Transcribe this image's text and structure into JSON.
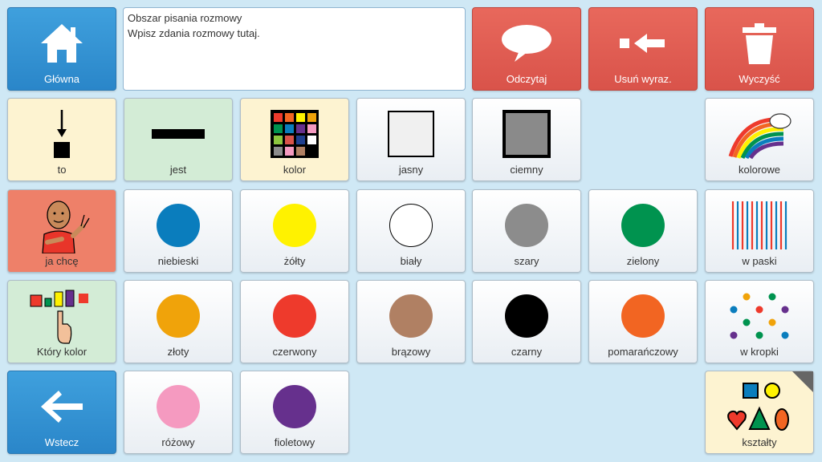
{
  "toolbar": {
    "home_label": "Główna",
    "speak_label": "Odczytaj",
    "delete_word_label": "Usuń wyraz.",
    "clear_label": "Wyczyść",
    "back_label": "Wstecz"
  },
  "message_area": {
    "line1": "Obszar pisania rozmowy",
    "line2": "Wpisz zdania rozmowy tutaj."
  },
  "words": {
    "to": "to",
    "jest": "jest",
    "kolor": "kolor",
    "jasny": "jasny",
    "ciemny": "ciemny",
    "kolorowe": "kolorowe",
    "ja_chce": "ja chcę",
    "w_paski": "w paski",
    "ktory_kolor": "Który kolor",
    "w_kropki": "w kropki",
    "ksztalty": "kształty"
  },
  "colors": {
    "niebieski": {
      "label": "niebieski",
      "hex": "#0a7dbd"
    },
    "zolty": {
      "label": "żółty",
      "hex": "#fff200"
    },
    "bialy": {
      "label": "biały",
      "hex": "#ffffff"
    },
    "szary": {
      "label": "szary",
      "hex": "#8c8c8c"
    },
    "zielony": {
      "label": "zielony",
      "hex": "#00934f"
    },
    "zloty": {
      "label": "złoty",
      "hex": "#f0a30a"
    },
    "czerwony": {
      "label": "czerwony",
      "hex": "#ee3a2c"
    },
    "brazowy": {
      "label": "brązowy",
      "hex": "#b08063"
    },
    "czarny": {
      "label": "czarny",
      "hex": "#000000"
    },
    "pomaranczowy": {
      "label": "pomarańczowy",
      "hex": "#f26522"
    },
    "rozowy": {
      "label": "różowy",
      "hex": "#f59ac0"
    },
    "fioletowy": {
      "label": "fioletowy",
      "hex": "#66308d"
    }
  },
  "accent": {
    "nav_blue": "#2a86c9",
    "action_red": "#d9534a",
    "background": "#cfe8f5"
  }
}
